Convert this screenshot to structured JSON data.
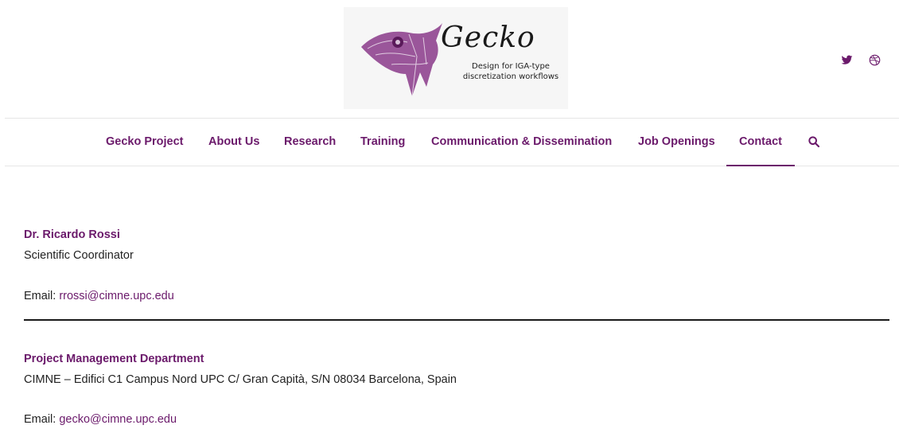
{
  "logo": {
    "title": "Gecko",
    "tagline_line1": "Design for IGA-type",
    "tagline_line2": "discretization workflows"
  },
  "social": {
    "twitter_icon": "twitter-icon",
    "dribbble_icon": "dribbble-icon"
  },
  "nav": {
    "items": [
      {
        "label": "Gecko Project"
      },
      {
        "label": "About Us"
      },
      {
        "label": "Research"
      },
      {
        "label": "Training"
      },
      {
        "label": "Communication & Dissemination"
      },
      {
        "label": "Job Openings"
      },
      {
        "label": "Contact"
      }
    ],
    "active": "Contact",
    "search_icon": "search-icon"
  },
  "contacts": [
    {
      "name": "Dr. Ricardo Rossi",
      "role": "Scientific Coordinator",
      "email_label": "Email:",
      "email": "rrossi@cimne.upc.edu"
    },
    {
      "name": "Project Management Department",
      "role": "CIMNE – Edifici C1 Campus Nord UPC C/ Gran Capità, S/N 08034 Barcelona, Spain",
      "email_label": "Email:",
      "email": "gecko@cimne.upc.edu"
    }
  ],
  "colors": {
    "brand": "#6b1a6b",
    "text": "#222222",
    "divider": "#1a1a1a"
  }
}
